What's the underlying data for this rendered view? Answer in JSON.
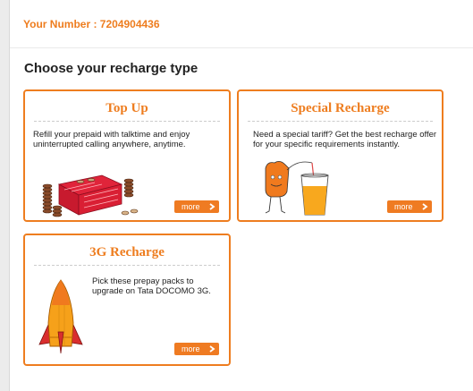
{
  "header": {
    "your_number": "Your Number : 7204904436"
  },
  "section": {
    "title": "Choose your recharge type"
  },
  "cards": [
    {
      "title": "Top Up",
      "description": "Refill your prepaid with talktime and enjoy uninterrupted calling anywhere, anytime.",
      "button": "more",
      "illustration": "coins-and-red-box"
    },
    {
      "title": "Special Recharge",
      "description": "Need a special tariff? Get the best recharge offer for your specific requirements instantly.",
      "button": "more",
      "illustration": "orange-mascot-with-juice"
    },
    {
      "title": "3G Recharge",
      "description": "Pick these prepay packs to upgrade on Tata DOCOMO 3G.",
      "button": "more",
      "illustration": "rocket"
    }
  ],
  "colors": {
    "accent": "#ee7d1f",
    "button": "#ef7b22",
    "text": "#222222"
  },
  "icons": {
    "more_arrow": "chevron-right-icon"
  }
}
